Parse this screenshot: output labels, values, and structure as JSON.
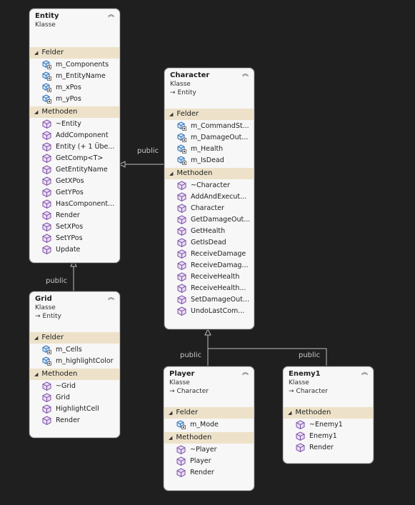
{
  "connectors": {
    "entity_character_label": "public",
    "entity_grid_label": "public",
    "character_player_label": "public",
    "character_enemy_label": "public"
  },
  "classes": {
    "entity": {
      "title": "Entity",
      "stereotype": "Klasse",
      "fields_label": "Felder",
      "methods_label": "Methoden",
      "fields": [
        "m_Components",
        "m_EntityName",
        "m_xPos",
        "m_yPos"
      ],
      "methods": [
        "~Entity",
        "AddComponent",
        "Entity (+ 1 Übe...",
        "GetComp<T>",
        "GetEntityName",
        "GetXPos",
        "GetYPos",
        "HasComponent...",
        "Render",
        "SetXPos",
        "SetYPos",
        "Update"
      ]
    },
    "character": {
      "title": "Character",
      "stereotype": "Klasse",
      "base": "Entity",
      "fields_label": "Felder",
      "methods_label": "Methoden",
      "fields": [
        "m_CommandSt...",
        "m_DamageOut...",
        "m_Health",
        "m_IsDead"
      ],
      "methods": [
        "~Character",
        "AddAndExecut...",
        "Character",
        "GetDamageOut...",
        "GetHealth",
        "GetIsDead",
        "ReceiveDamage",
        "ReceiveDamag...",
        "ReceiveHealth",
        "ReceiveHealth...",
        "SetDamageOut...",
        "UndoLastCom..."
      ]
    },
    "grid": {
      "title": "Grid",
      "stereotype": "Klasse",
      "base": "Entity",
      "fields_label": "Felder",
      "methods_label": "Methoden",
      "fields": [
        "m_Cells",
        "m_highlightColor"
      ],
      "methods": [
        "~Grid",
        "Grid",
        "HighlightCell",
        "Render"
      ]
    },
    "player": {
      "title": "Player",
      "stereotype": "Klasse",
      "base": "Character",
      "fields_label": "Felder",
      "methods_label": "Methoden",
      "fields": [
        "m_Mode"
      ],
      "methods": [
        "~Player",
        "Player",
        "Render"
      ]
    },
    "enemy1": {
      "title": "Enemy1",
      "stereotype": "Klasse",
      "base": "Character",
      "methods_label": "Methoden",
      "methods": [
        "~Enemy1",
        "Enemy1",
        "Render"
      ]
    }
  },
  "colors": {
    "background": "#1f1f1f",
    "box": "#f7f7f7",
    "section_header": "#ede2c9",
    "connector": "#bdbdbd",
    "method_icon": "#7b4fa6",
    "field_icon": "#2b6fb8"
  }
}
